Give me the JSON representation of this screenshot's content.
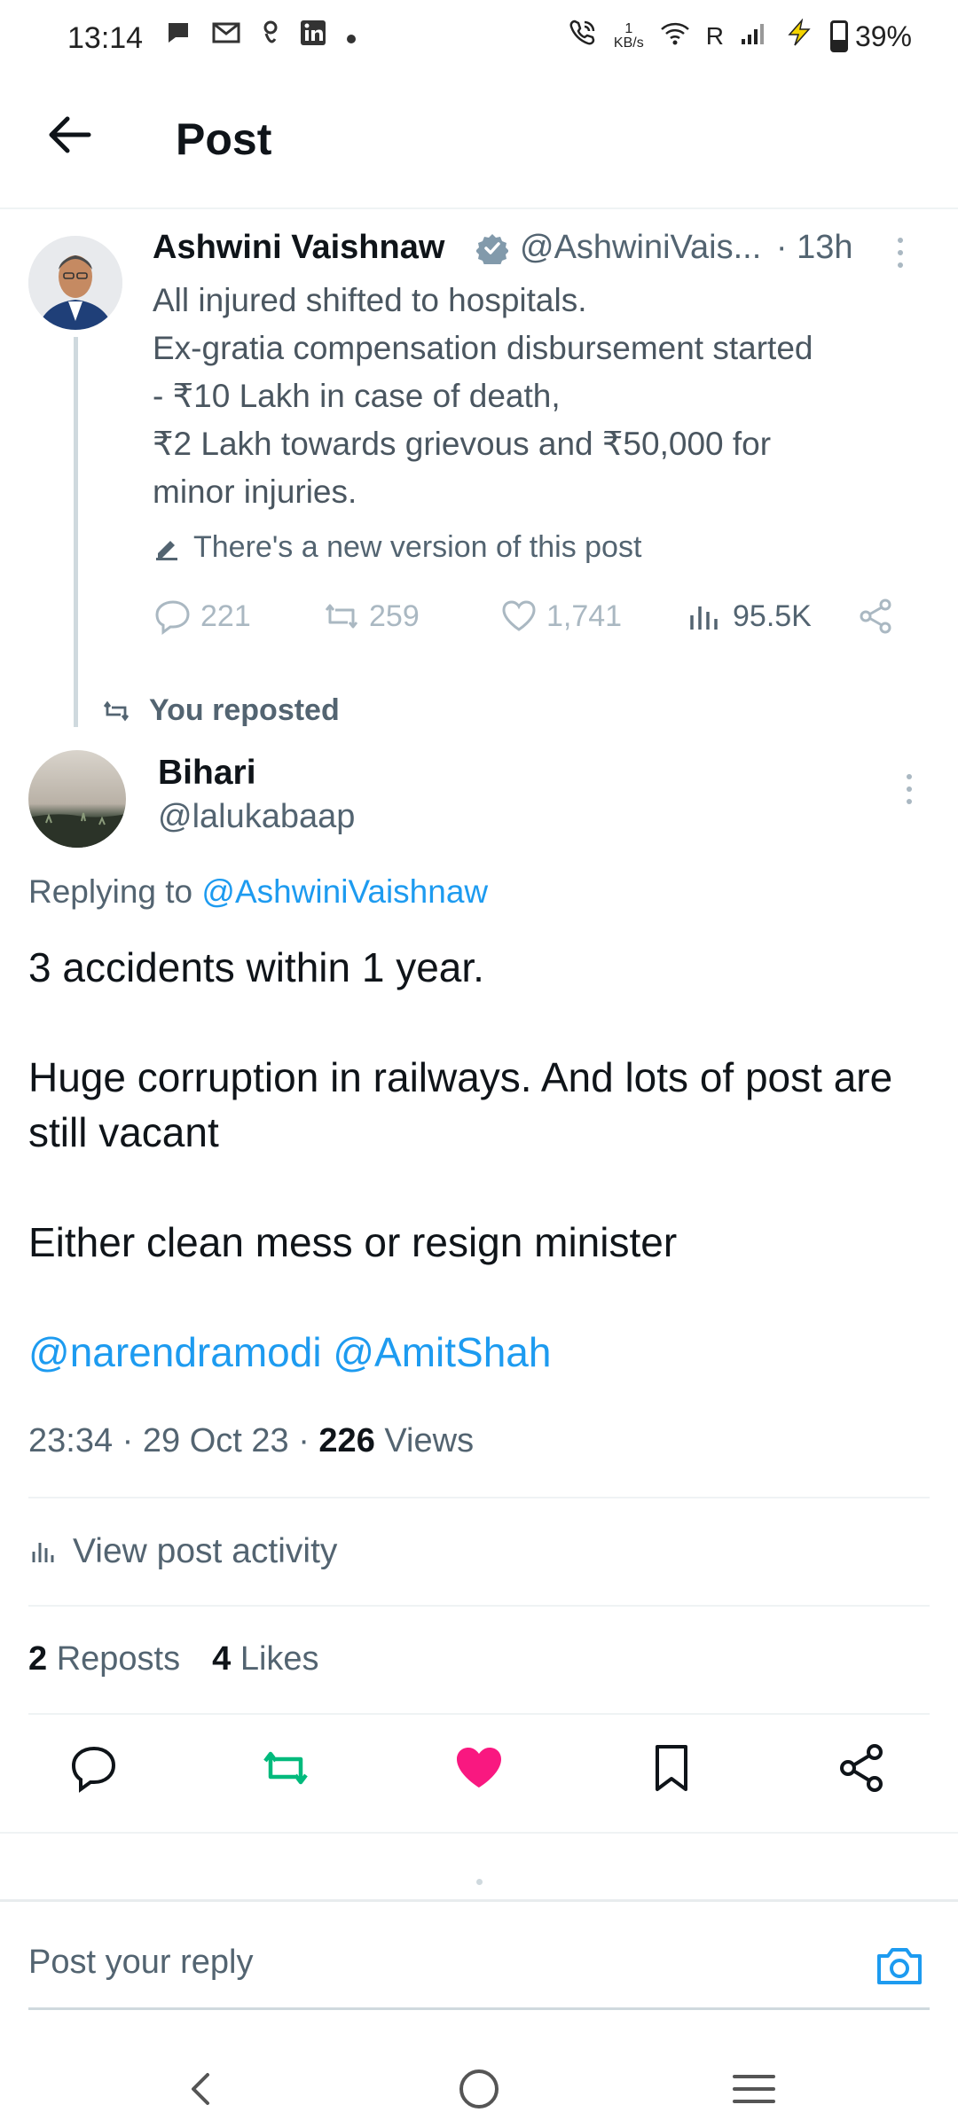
{
  "status_bar": {
    "time": "13:14",
    "left_icons": [
      "chat-bubble-icon",
      "gmail-icon",
      "app-icon",
      "linkedin-icon",
      "dot-icon"
    ],
    "network_speed_value": "1",
    "network_speed_unit": "KB/s",
    "carrier_label": "R",
    "battery_percent": "39%"
  },
  "header": {
    "title": "Post"
  },
  "parent_tweet": {
    "name": "Ashwini Vaishnaw",
    "handle": "@AshwiniVais...",
    "time": "· 13h",
    "lines": [
      "All injured shifted to hospitals.",
      "Ex-gratia compensation disbursement started",
      "- ₹10 Lakh in case of death,",
      "₹2 Lakh towards grievous and ₹50,000 for",
      "minor injuries."
    ],
    "edit_notice": "There's a new version of this post",
    "replies": "221",
    "reposts": "259",
    "likes": "1,741",
    "views": "95.5K"
  },
  "repost_label": "You reposted",
  "main_tweet": {
    "name": "Bihari",
    "handle": "@lalukabaap",
    "replying_prefix": "Replying to",
    "replying_handle": "@AshwiniVaishnaw",
    "paragraphs": [
      "3 accidents within 1 year.",
      "Huge corruption in railways. And lots of post are still vacant",
      "Either clean mess or resign minister"
    ],
    "mentions": "@narendramodi @AmitShah",
    "time": "23:34",
    "date": "29 Oct 23",
    "views_count": "226",
    "views_label": "Views",
    "activity_label": "View post activity",
    "reposts_count": "2",
    "reposts_label": "Reposts",
    "likes_count": "4",
    "likes_label": "Likes"
  },
  "reply_bar": {
    "placeholder": "Post your reply"
  },
  "colors": {
    "accent_blue": "#1d9bf0",
    "repost_green": "#00ba7c",
    "like_pink": "#f91880",
    "secondary_text": "#536471"
  }
}
